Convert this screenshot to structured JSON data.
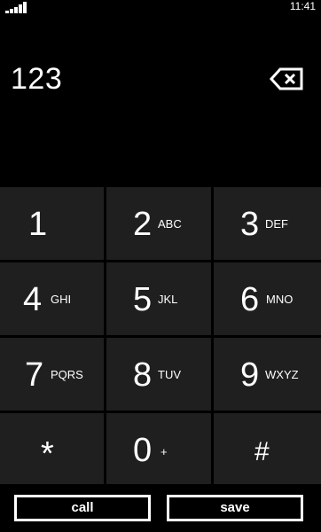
{
  "status_bar": {
    "time": "11:41",
    "signal_icon": "signal-strength-icon"
  },
  "display": {
    "number": "123",
    "backspace_icon": "backspace-icon"
  },
  "keypad": {
    "keys": [
      {
        "digit": "1",
        "letters": ""
      },
      {
        "digit": "2",
        "letters": "ABC"
      },
      {
        "digit": "3",
        "letters": "DEF"
      },
      {
        "digit": "4",
        "letters": "GHI"
      },
      {
        "digit": "5",
        "letters": "JKL"
      },
      {
        "digit": "6",
        "letters": "MNO"
      },
      {
        "digit": "7",
        "letters": "PQRS"
      },
      {
        "digit": "8",
        "letters": "TUV"
      },
      {
        "digit": "9",
        "letters": "WXYZ"
      },
      {
        "digit": "*",
        "letters": ""
      },
      {
        "digit": "0",
        "letters": "+"
      },
      {
        "digit": "#",
        "letters": ""
      }
    ]
  },
  "actions": {
    "call_label": "call",
    "save_label": "save"
  },
  "colors": {
    "background": "#000000",
    "key_background": "#1f1f1f",
    "text": "#ffffff"
  }
}
